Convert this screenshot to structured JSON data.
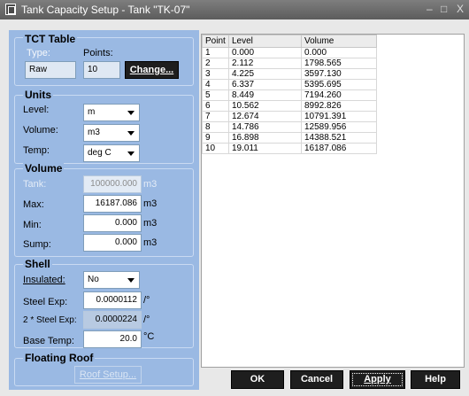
{
  "window": {
    "title": "Tank Capacity Setup - Tank \"TK-07\"",
    "controls": {
      "minimize": "–",
      "maximize": "□",
      "close": "X"
    }
  },
  "tct_table": {
    "heading": "TCT Table",
    "type_label": "Type:",
    "points_label": "Points:",
    "type_value": "Raw",
    "points_value": "10",
    "change_button": "Change..."
  },
  "units": {
    "heading": "Units",
    "level_label": "Level:",
    "level_value": "m",
    "volume_label": "Volume:",
    "volume_value": "m3",
    "temp_label": "Temp:",
    "temp_value": "deg C"
  },
  "volume": {
    "heading": "Volume",
    "tank_label": "Tank:",
    "tank_value": "100000.000",
    "tank_unit": "m3",
    "max_label": "Max:",
    "max_value": "16187.086",
    "max_unit": "m3",
    "min_label": "Min:",
    "min_value": "0.000",
    "min_unit": "m3",
    "sump_label": "Sump:",
    "sump_value": "0.000",
    "sump_unit": "m3"
  },
  "shell": {
    "heading": "Shell",
    "insulated_label": "Insulated:",
    "insulated_value": "No",
    "steel_exp_label": "Steel Exp:",
    "steel_exp_value": "0.0000112",
    "steel_exp_unit": "/°",
    "steel_exp2_label": "2 * Steel Exp:",
    "steel_exp2_value": "0.0000224",
    "steel_exp2_unit": "/°",
    "base_temp_label": "Base Temp:",
    "base_temp_value": "20.0",
    "base_temp_unit": "°C"
  },
  "floating_roof": {
    "heading": "Floating Roof",
    "roof_setup_button": "Roof Setup..."
  },
  "table": {
    "headers": [
      "Point",
      "Level",
      "Volume"
    ],
    "rows": [
      [
        "1",
        "0.000",
        "0.000"
      ],
      [
        "2",
        "2.112",
        "1798.565"
      ],
      [
        "3",
        "4.225",
        "3597.130"
      ],
      [
        "4",
        "6.337",
        "5395.695"
      ],
      [
        "5",
        "8.449",
        "7194.260"
      ],
      [
        "6",
        "10.562",
        "8992.826"
      ],
      [
        "7",
        "12.674",
        "10791.391"
      ],
      [
        "8",
        "14.786",
        "12589.956"
      ],
      [
        "9",
        "16.898",
        "14388.521"
      ],
      [
        "10",
        "19.011",
        "16187.086"
      ]
    ]
  },
  "footer": {
    "ok": "OK",
    "cancel": "Cancel",
    "apply": "Apply",
    "help": "Help"
  }
}
